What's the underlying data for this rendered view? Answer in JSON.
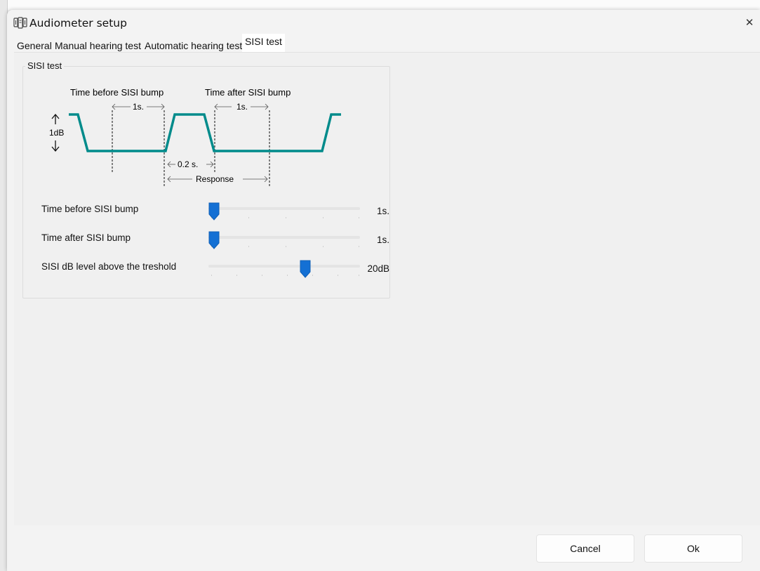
{
  "window": {
    "title": "Audiometer setup",
    "close_glyph": "✕"
  },
  "tabs": [
    {
      "label": "General",
      "active": false
    },
    {
      "label": "Manual hearing test",
      "active": false
    },
    {
      "label": "Automatic hearing test",
      "active": false
    },
    {
      "label": "SISI test",
      "active": true
    }
  ],
  "group": {
    "title": "SISI test",
    "diagram": {
      "time_before_label": "Time before SISI bump",
      "time_after_label": "Time after SISI bump",
      "before_interval": "1s.",
      "after_interval": "1s.",
      "amplitude_label": "1dB",
      "bump_duration": "0.2 s.",
      "response_label": "Response",
      "waveform_color": "#008b8b"
    },
    "settings": [
      {
        "label": "Time before SISI bump",
        "value_text": "1s.",
        "position": 0.0
      },
      {
        "label": "Time after SISI bump",
        "value_text": "1s.",
        "position": 0.0
      },
      {
        "label": "SISI dB level above the treshold",
        "value_text": "20dB",
        "position": 0.65
      }
    ]
  },
  "buttons": {
    "cancel": "Cancel",
    "ok": "Ok"
  },
  "colors": {
    "accent": "#1470d4",
    "track": "#e4e4e4"
  },
  "icons": {
    "app": "audiometer-icon",
    "close": "close-icon"
  }
}
